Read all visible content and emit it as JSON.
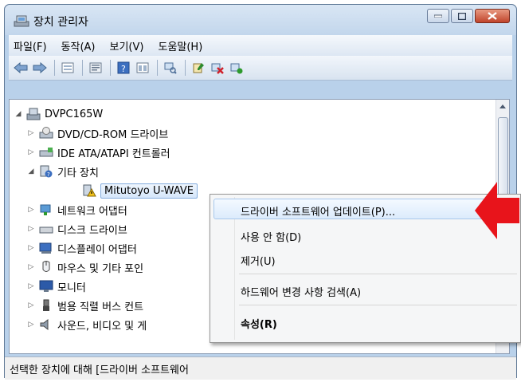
{
  "window": {
    "title": "장치 관리자"
  },
  "menu": [
    "파일(F)",
    "동작(A)",
    "보기(V)",
    "도움말(H)"
  ],
  "toolbar_icons": [
    "back-icon",
    "forward-icon",
    "view-icon",
    "properties-icon",
    "help-icon",
    "view2-icon",
    "scan-icon",
    "update-icon",
    "uninstall-icon",
    "enable-icon"
  ],
  "tree": {
    "root": "DVPC165W",
    "items": [
      {
        "label": "DVD/CD-ROM 드라이브",
        "icon": "dvd-drive-icon"
      },
      {
        "label": "IDE ATA/ATAPI 컨트롤러",
        "icon": "ide-controller-icon"
      },
      {
        "label": "기타 장치",
        "icon": "other-devices-icon"
      },
      {
        "label": "Mitutoyo U-WAVE",
        "icon": "unknown-device-icon"
      },
      {
        "label": "네트워크 어댑터",
        "icon": "network-adapter-icon"
      },
      {
        "label": "디스크 드라이브",
        "icon": "disk-drive-icon"
      },
      {
        "label": "디스플레이 어댑터",
        "icon": "display-adapter-icon"
      },
      {
        "label": "마우스 및 기타 포인",
        "icon": "mouse-icon"
      },
      {
        "label": "모니터",
        "icon": "monitor-icon"
      },
      {
        "label": "범용 직렬 버스 컨트",
        "icon": "usb-icon"
      },
      {
        "label": "사운드, 비디오 및 게",
        "icon": "sound-icon"
      }
    ]
  },
  "context_menu": [
    {
      "label": "드라이버 소프트웨어 업데이트(P)..."
    },
    {
      "label": "사용 안 함(D)"
    },
    {
      "label": "제거(U)"
    },
    {
      "label": "하드웨어 변경 사항 검색(A)"
    },
    {
      "label": "속성(R)"
    }
  ],
  "status": "선택한 장치에 대해 [드라이버 소프트웨어",
  "colors": {
    "arrow": "#e8141b",
    "selection": "#d5e6fa"
  }
}
